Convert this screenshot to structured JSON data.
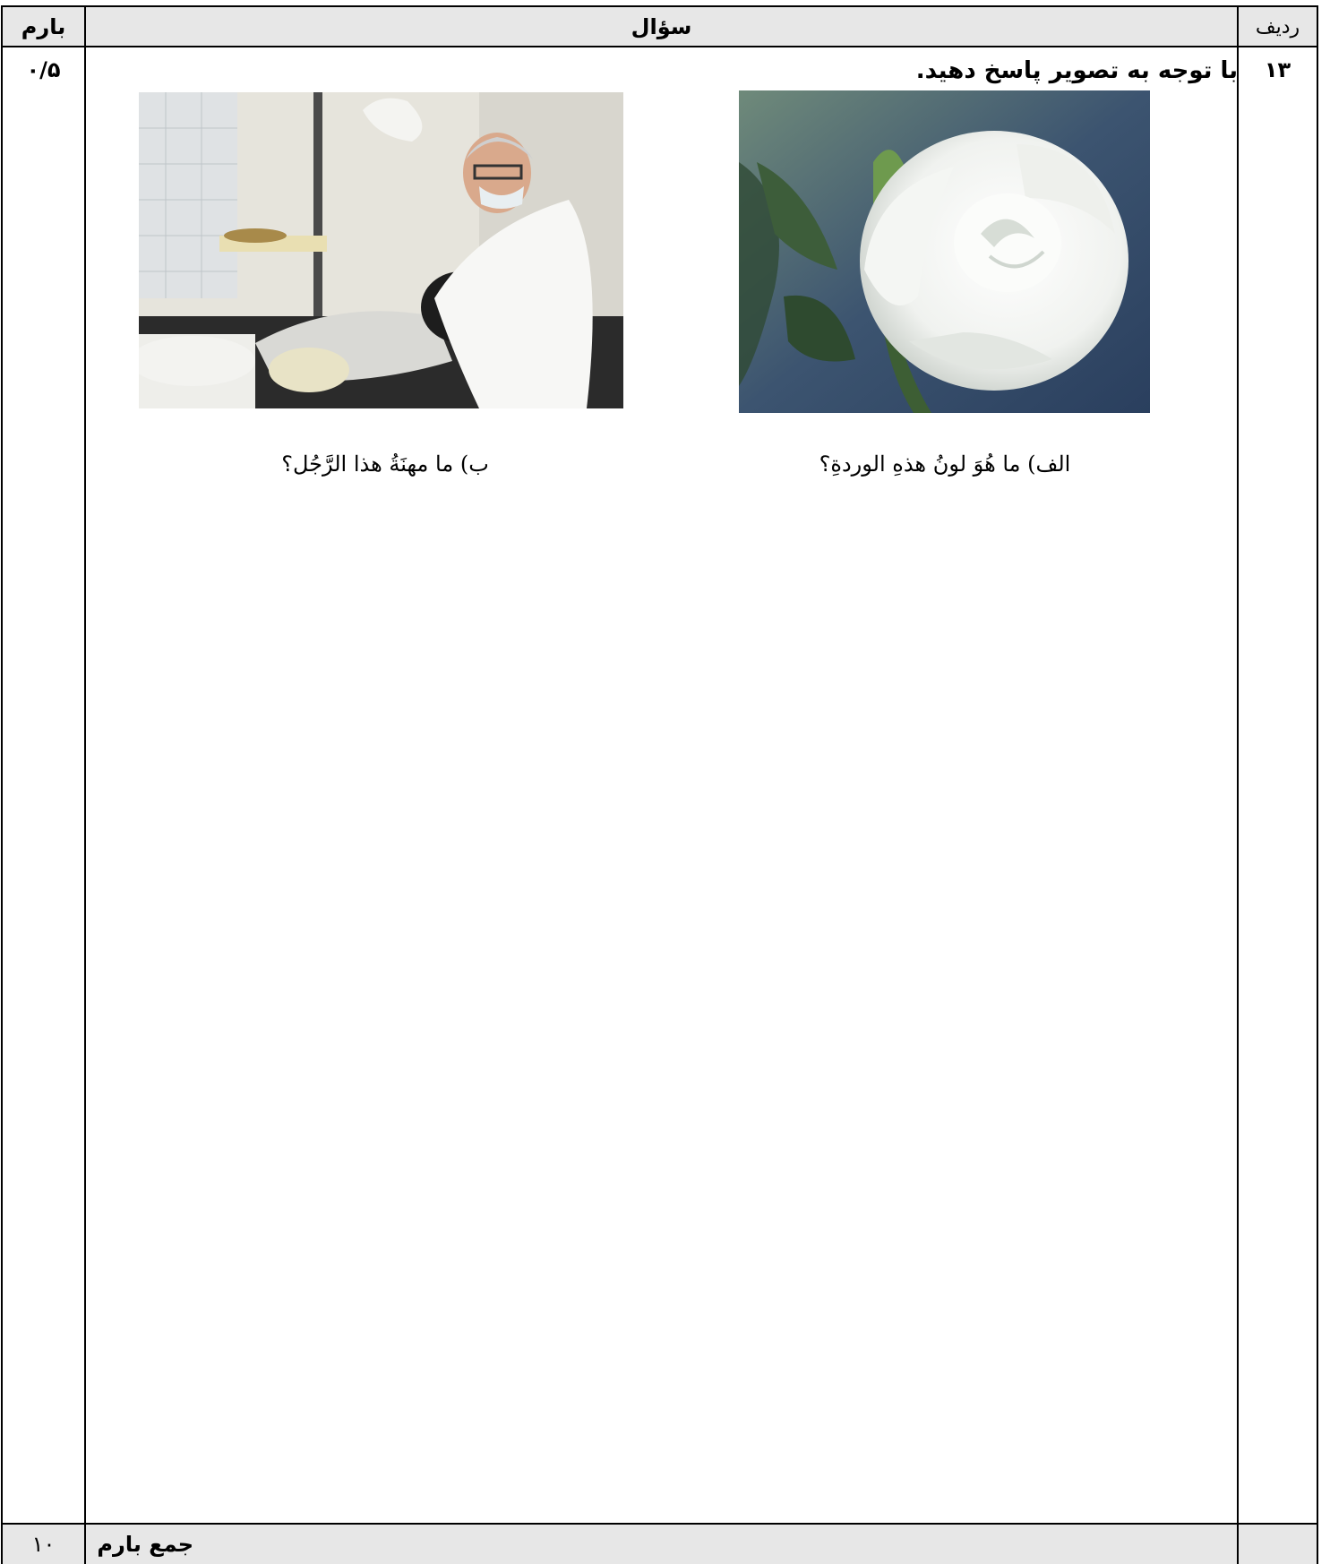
{
  "header": {
    "score_label": "بارم",
    "question_label": "سؤال",
    "row_label": "ردیف"
  },
  "question": {
    "row_number": "۱۳",
    "score": "۰/۵",
    "instruction": "با توجه به تصویر پاسخ دهید.",
    "part_a": "الف) ما هُوَ لونُ هذهِ الوردةِ؟",
    "part_b": "ب) ما مهنَةُ هذا الرَّجُل؟"
  },
  "footer": {
    "total_label": "جمع بارم",
    "total_value": "۱۰"
  }
}
